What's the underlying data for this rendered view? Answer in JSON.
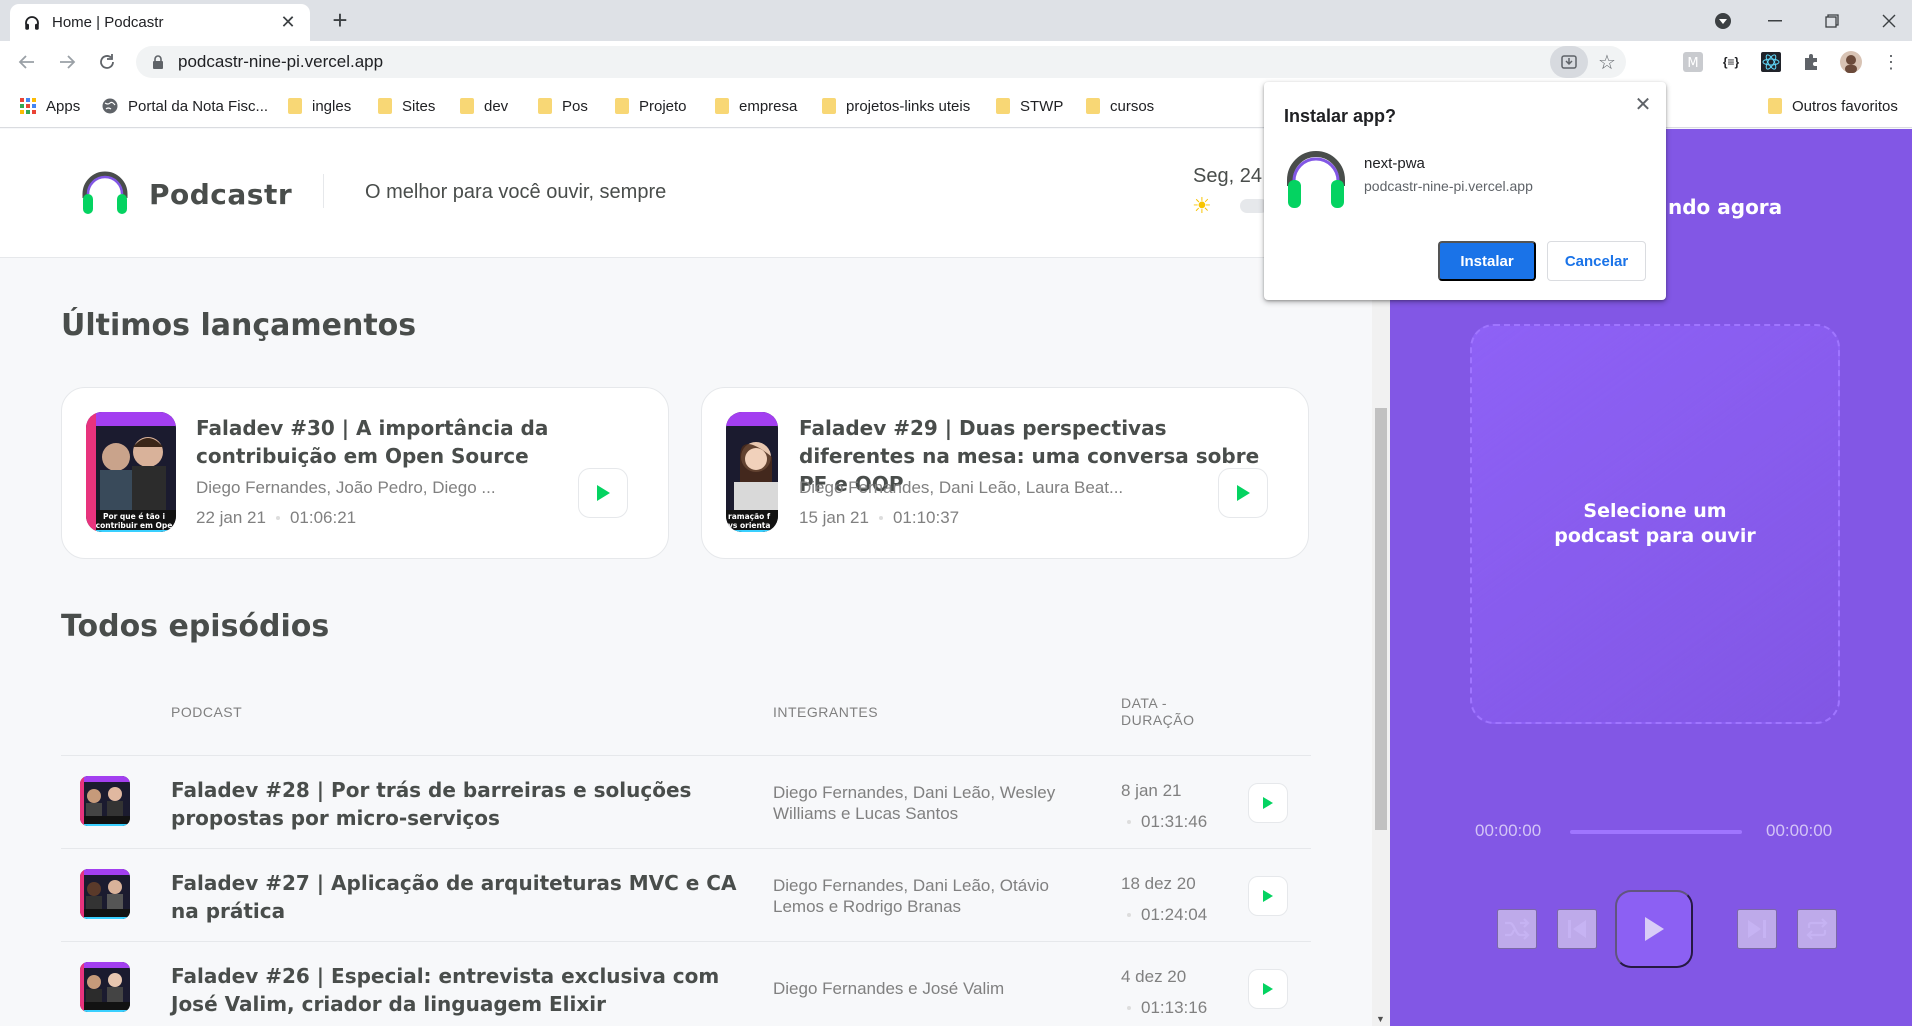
{
  "browser": {
    "tab_title": "Home | Podcastr",
    "url": "podcastr-nine-pi.vercel.app",
    "bookmarks": [
      {
        "label": "Apps",
        "icon": "apps-icon"
      },
      {
        "label": "Portal da Nota Fisc...",
        "icon": "globe-icon"
      },
      {
        "label": "ingles",
        "icon": "folder-icon"
      },
      {
        "label": "Sites",
        "icon": "folder-icon"
      },
      {
        "label": "dev",
        "icon": "folder-icon"
      },
      {
        "label": "Pos",
        "icon": "folder-icon"
      },
      {
        "label": "Projeto",
        "icon": "folder-icon"
      },
      {
        "label": "empresa",
        "icon": "folder-icon"
      },
      {
        "label": "projetos-links uteis",
        "icon": "folder-icon"
      },
      {
        "label": "STWP",
        "icon": "folder-icon"
      },
      {
        "label": "cursos",
        "icon": "folder-icon"
      }
    ],
    "other_bookmarks": "Outros favoritos"
  },
  "header": {
    "brand": "Podcastr",
    "tagline": "O melhor para você ouvir, sempre",
    "date": "Seg, 24"
  },
  "latest": {
    "title": "Últimos lançamentos",
    "episodes": [
      {
        "title": "Faladev #30 | A importância da contribuição em Open Source",
        "members": "Diego Fernandes, João Pedro, Diego ...",
        "date": "22 jan 21",
        "duration": "01:06:21",
        "thumb_text": "Por que é tão i contribuir em Ope"
      },
      {
        "title": "Faladev #29 | Duas perspectivas diferentes na mesa: uma conversa sobre PF e OOP",
        "members": "Diego Fernandes, Dani Leão, Laura Beat...",
        "date": "15 jan 21",
        "duration": "01:10:37",
        "thumb_text": "ramação f vs orienta"
      }
    ]
  },
  "all": {
    "title": "Todos episódios",
    "columns": {
      "podcast": "PODCAST",
      "members": "INTEGRANTES",
      "date": "DATA -",
      "duration": "DURAÇÃO"
    },
    "episodes": [
      {
        "title": "Faladev #28 | Por trás de barreiras e soluções propostas por micro-serviços",
        "members": "Diego Fernandes, Dani Leão, Wesley Williams e Lucas Santos",
        "date": "8 jan 21",
        "duration": "01:31:46"
      },
      {
        "title": "Faladev #27 | Aplicação de arquiteturas MVC e CA na prática",
        "members": "Diego Fernandes, Dani Leão, Otávio Lemos e Rodrigo Branas",
        "date": "18 dez 20",
        "duration": "01:24:04"
      },
      {
        "title": "Faladev #26 | Especial: entrevista exclusiva com José Valim, criador da linguagem Elixir",
        "members": "Diego Fernandes e José Valim",
        "date": "4 dez 20",
        "duration": "01:13:16"
      }
    ]
  },
  "player": {
    "now_playing": "ndo agora",
    "empty_text": "Selecione um podcast para ouvir",
    "current_time": "00:00:00",
    "total_time": "00:00:00"
  },
  "install_popup": {
    "title": "Instalar app?",
    "app_name": "next-pwa",
    "app_url": "podcastr-nine-pi.vercel.app",
    "install_label": "Instalar",
    "cancel_label": "Cancelar"
  },
  "colors": {
    "brand_purple": "#8257e5",
    "green": "#04d361",
    "install_blue": "#1a73e8"
  }
}
